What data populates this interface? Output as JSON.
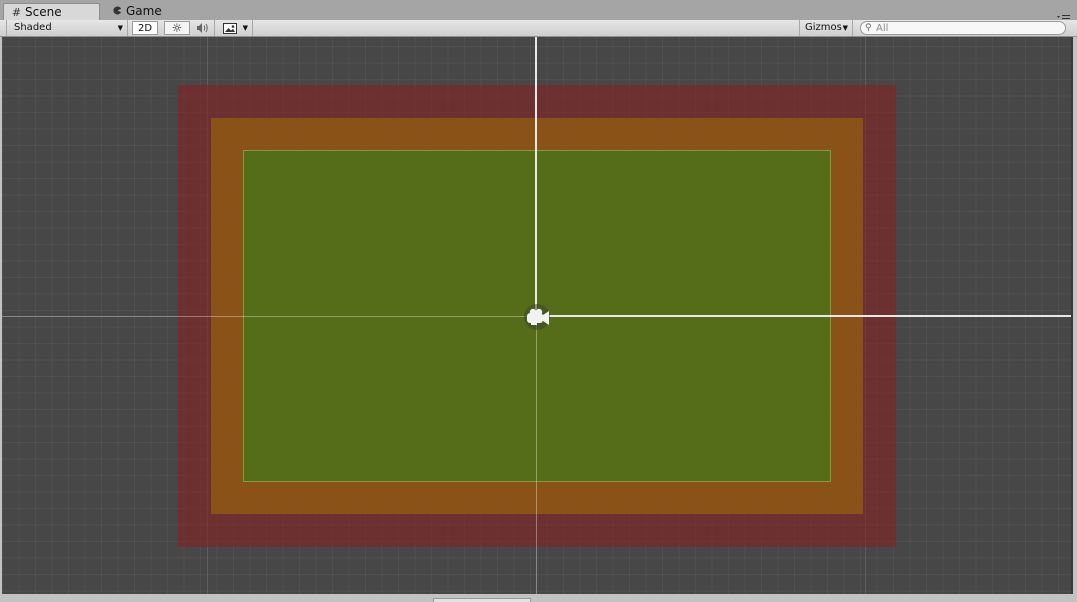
{
  "tabs": [
    {
      "label": "Scene",
      "icon": "hash-grid-icon",
      "active": true
    },
    {
      "label": "Game",
      "icon": "pacman-icon",
      "active": false
    }
  ],
  "toolbar": {
    "shading_mode": "Shaded",
    "mode_2d_label": "2D",
    "lighting_icon": "sun-icon",
    "audio_icon": "speaker-icon",
    "effects_icon": "image-icon",
    "gizmos_label": "Gizmos",
    "search_placeholder": "All"
  },
  "scene": {
    "grid_color": "#474747",
    "outer_bounds_color": "#8c1e1e",
    "middle_bounds_color": "#915a14",
    "inner_bounds_color": "#546e19",
    "gizmo_icon": "camera-icon"
  }
}
